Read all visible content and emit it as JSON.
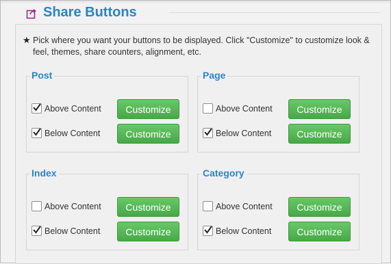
{
  "title": "Share Buttons",
  "description_star": "★",
  "description": "Pick where you want your buttons to be displayed. Click \"Customize\" to customize look & feel, themes, share counters, alignment, etc.",
  "sections": [
    {
      "title": "Post",
      "options": [
        {
          "label": "Above Content",
          "checked": true,
          "button": "Customize"
        },
        {
          "label": "Below Content",
          "checked": true,
          "button": "Customize"
        }
      ]
    },
    {
      "title": "Page",
      "options": [
        {
          "label": "Above Content",
          "checked": false,
          "button": "Customize"
        },
        {
          "label": "Below Content",
          "checked": true,
          "button": "Customize"
        }
      ]
    },
    {
      "title": "Index",
      "options": [
        {
          "label": "Above Content",
          "checked": false,
          "button": "Customize"
        },
        {
          "label": "Below Content",
          "checked": true,
          "button": "Customize"
        }
      ]
    },
    {
      "title": "Category",
      "options": [
        {
          "label": "Above Content",
          "checked": false,
          "button": "Customize"
        },
        {
          "label": "Below Content",
          "checked": true,
          "button": "Customize"
        }
      ]
    }
  ],
  "colors": {
    "accent": "#2a85c6",
    "button": "#4cae4c",
    "icon": "#9b2c8f"
  }
}
